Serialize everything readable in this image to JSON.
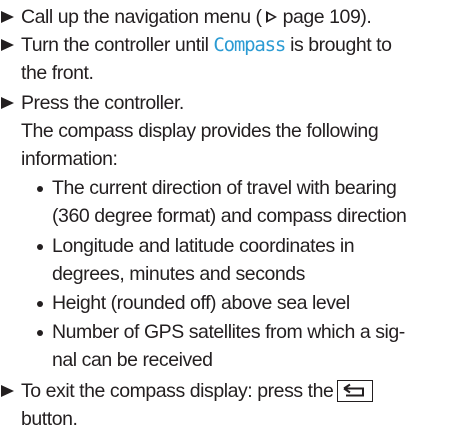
{
  "steps": {
    "s1": {
      "before": "Call up the navigation menu (",
      "after": "page 109)."
    },
    "s2": {
      "before": "Turn the controller until ",
      "term": "Compass",
      "after": " is brought to",
      "line2": "the front."
    },
    "s3": {
      "line1": "Press the controller.",
      "line2": "The compass display provides the following",
      "line3": "information:"
    },
    "s4": {
      "text": "To exit the compass display: press the",
      "line2": "button."
    }
  },
  "bullets": {
    "b1": {
      "line1": "The current direction of travel with bearing",
      "line2": "(360 degree format) and compass direction"
    },
    "b2": {
      "line1": "Longitude and latitude coordinates in",
      "line2": "degrees, minutes and seconds"
    },
    "b3": {
      "line1": "Height (rounded off) above sea level"
    },
    "b4": {
      "line1": "Number of GPS satellites from which a sig-",
      "line2": "nal can be received"
    }
  },
  "colors": {
    "text": "#231f20",
    "accent": "#2b9bd3"
  },
  "icons": {
    "step": "arrow-right-icon",
    "page_reference": "page-reference-icon",
    "back_button": "back-button-icon"
  }
}
